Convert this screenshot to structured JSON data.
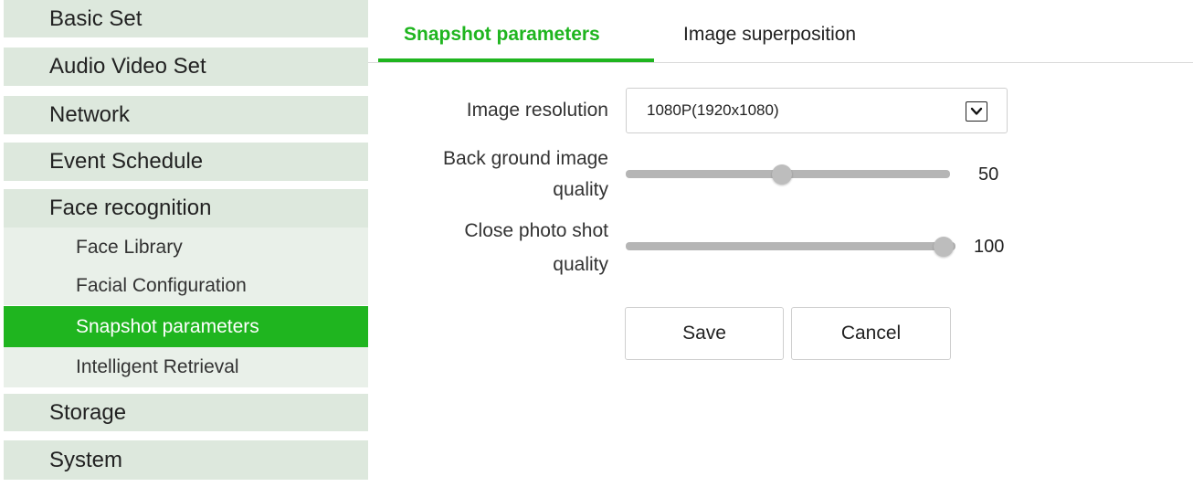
{
  "sidebar": {
    "menu": [
      {
        "label": "Basic Set"
      },
      {
        "label": "Audio Video Set"
      },
      {
        "label": "Network"
      },
      {
        "label": "Event Schedule"
      },
      {
        "label": "Face recognition"
      }
    ],
    "submenu": [
      {
        "label": "Face Library"
      },
      {
        "label": "Facial Configuration"
      },
      {
        "label": "Snapshot parameters",
        "active": true
      },
      {
        "label": "Intelligent Retrieval"
      }
    ],
    "menu_after": [
      {
        "label": "Storage"
      },
      {
        "label": "System"
      }
    ]
  },
  "tabs": [
    {
      "label": "Snapshot parameters",
      "active": true
    },
    {
      "label": "Image superposition",
      "active": false
    }
  ],
  "form": {
    "resolution": {
      "label": "Image resolution",
      "value": "1080P(1920x1080)"
    },
    "bg_quality": {
      "label_line1": "Back ground image",
      "label_line2": "quality",
      "value": "50"
    },
    "close_quality": {
      "label_line1": "Close photo shot",
      "label_line2": "quality",
      "value": "100"
    },
    "save_label": "Save",
    "cancel_label": "Cancel"
  },
  "colors": {
    "accent": "#1fb51f",
    "menu_bg": "#dde8dd",
    "submenu_bg": "#e9f0e9"
  }
}
